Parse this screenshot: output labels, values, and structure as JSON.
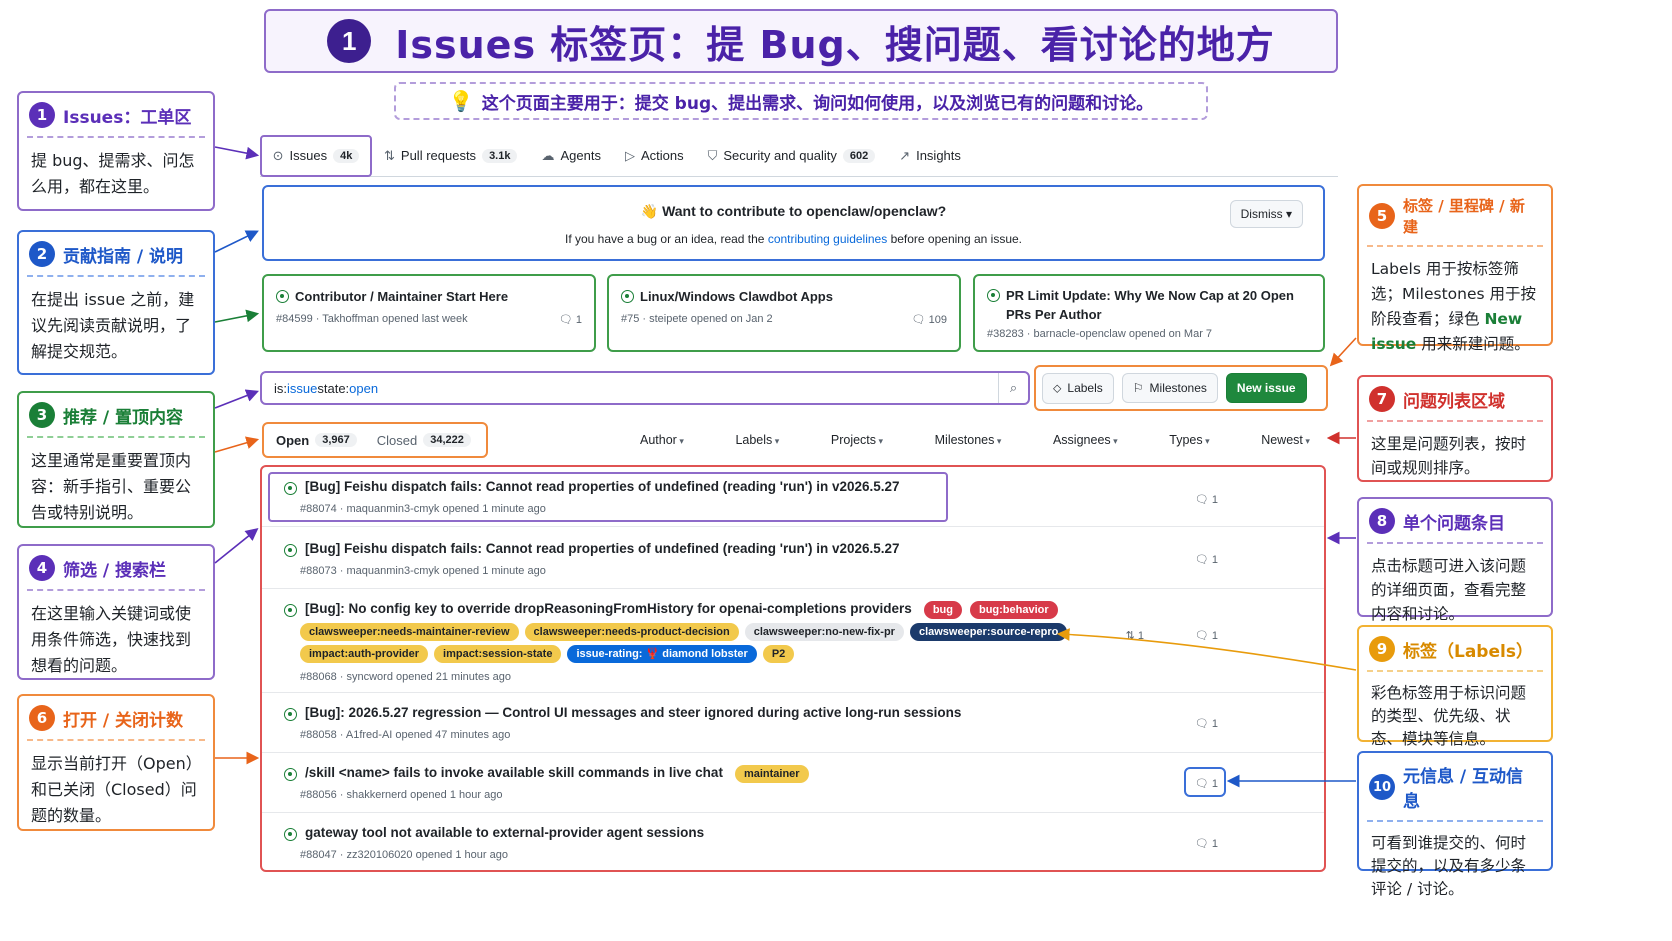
{
  "title": {
    "num": "1",
    "text": "Issues 标签页：提 Bug、搜问题、看讨论的地方"
  },
  "subtitle": "这个页面主要用于：提交 bug、提出需求、询问如何使用，以及浏览已有的问题和讨论。",
  "callouts": {
    "c1": {
      "num": "1",
      "title": "Issues：工单区",
      "body": "提 bug、提需求、问怎么用，都在这里。"
    },
    "c2": {
      "num": "2",
      "title": "贡献指南 / 说明",
      "body": "在提出 issue 之前，建议先阅读贡献说明，了解提交规范。"
    },
    "c3": {
      "num": "3",
      "title": "推荐 / 置顶内容",
      "body": "这里通常是重要置顶内容：新手指引、重要公告或特别说明。"
    },
    "c4": {
      "num": "4",
      "title": "筛选 / 搜索栏",
      "body": "在这里输入关键词或使用条件筛选，快速找到想看的问题。"
    },
    "c5": {
      "num": "5",
      "title": "标签 / 里程碑 / 新建",
      "body_a": "Labels 用于按标签筛选；Milestones 用于按阶段查看；绿色 ",
      "body_green": "New issue",
      "body_b": " 用来新建问题。"
    },
    "c6": {
      "num": "6",
      "title": "打开 / 关闭计数",
      "body": "显示当前打开（Open）和已关闭（Closed）问题的数量。"
    },
    "c7": {
      "num": "7",
      "title": "问题列表区域",
      "body": "这里是问题列表，按时间或规则排序。"
    },
    "c8": {
      "num": "8",
      "title": "单个问题条目",
      "body": "点击标题可进入该问题的详细页面，查看完整内容和讨论。"
    },
    "c9": {
      "num": "9",
      "title": "标签（Labels）",
      "body": "彩色标签用于标识问题的类型、优先级、状态、模块等信息。"
    },
    "c10": {
      "num": "10",
      "title": "元信息 / 互动信息",
      "body": "可看到谁提交的、何时提交的，以及有多少条评论 / 讨论。"
    }
  },
  "tabs": [
    {
      "label": "Issues",
      "count": "4k",
      "icon": "issue-icon"
    },
    {
      "label": "Pull requests",
      "count": "3.1k",
      "icon": "pull-request-icon"
    },
    {
      "label": "Agents",
      "count": "",
      "icon": "agents-icon"
    },
    {
      "label": "Actions",
      "count": "",
      "icon": "play-icon"
    },
    {
      "label": "Security and quality",
      "count": "602",
      "icon": "shield-icon"
    },
    {
      "label": "Insights",
      "count": "",
      "icon": "graph-icon"
    }
  ],
  "banner": {
    "title": "👋 Want to contribute to openclaw/openclaw?",
    "text_a": "If you have a bug or an idea, read the ",
    "link": "contributing guidelines",
    "text_b": " before opening an issue.",
    "dismiss": "Dismiss"
  },
  "pinned": [
    {
      "title": "Contributor / Maintainer Start Here",
      "meta": "#84599 · Takhoffman opened last week",
      "comments": "1"
    },
    {
      "title": "Linux/Windows Clawdbot Apps",
      "meta": "#75 · steipete opened on Jan 2",
      "comments": "109"
    },
    {
      "title": "PR Limit Update: Why We Now Cap at 20 Open PRs Per Author",
      "meta": "#38283 · barnacle-openclaw opened on Mar 7",
      "comments": ""
    }
  ],
  "search": {
    "prefix1": "is:",
    "kw1": "issue",
    "prefix2": " state:",
    "kw2": "open"
  },
  "actions": {
    "labels": "Labels",
    "milestones": "Milestones",
    "new_issue": "New issue"
  },
  "counts": {
    "open_label": "Open",
    "open": "3,967",
    "closed_label": "Closed",
    "closed": "34,222"
  },
  "filters": [
    "Author",
    "Labels",
    "Projects",
    "Milestones",
    "Assignees",
    "Types",
    "Newest"
  ],
  "issues": [
    {
      "title": "[Bug] Feishu dispatch fails: Cannot read properties of undefined (reading 'run') in v2026.5.27",
      "meta": "#88074 · maquanmin3-cmyk opened 1 minute ago",
      "comments": "1"
    },
    {
      "title": "[Bug] Feishu dispatch fails: Cannot read properties of undefined (reading 'run') in v2026.5.27",
      "meta": "#88073 · maquanmin3-cmyk opened 1 minute ago",
      "comments": "1"
    },
    {
      "title": "[Bug]: No config key to override dropReasoningFromHistory for openai-completions providers",
      "meta": "#88068 · syncword opened 21 minutes ago",
      "comments": "1",
      "prs": "1"
    },
    {
      "title": "[Bug]: 2026.5.27 regression — Control UI messages and steer ignored during active long-run sessions",
      "meta": "#88058 · A1fred-AI opened 47 minutes ago",
      "comments": "1"
    },
    {
      "title": "/skill <name> fails to invoke available skill commands in live chat",
      "meta": "#88056 · shakkernerd opened 1 hour ago",
      "comments": "1"
    },
    {
      "title": "gateway tool not available to external-provider agent sessions",
      "meta": "#88047 · zz320106020 opened 1 hour ago",
      "comments": "1"
    }
  ],
  "labels": {
    "bug": "bug",
    "bug_behavior": "bug:behavior",
    "l1": "clawsweeper:needs-maintainer-review",
    "l2": "clawsweeper:needs-product-decision",
    "l3": "clawsweeper:no-new-fix-pr",
    "l4": "clawsweeper:source-repro",
    "l5": "impact:auth-provider",
    "l6": "impact:session-state",
    "l7": "issue-rating: 🦞 diamond lobster",
    "l8": "P2",
    "maintainer": "maintainer"
  },
  "colors": {
    "purple": "#8e6bc9",
    "blue": "#3a6fd8",
    "green": "#3f9d4a",
    "orange": "#f08a3c",
    "red": "#e05353",
    "yellow": "#f2b233"
  }
}
